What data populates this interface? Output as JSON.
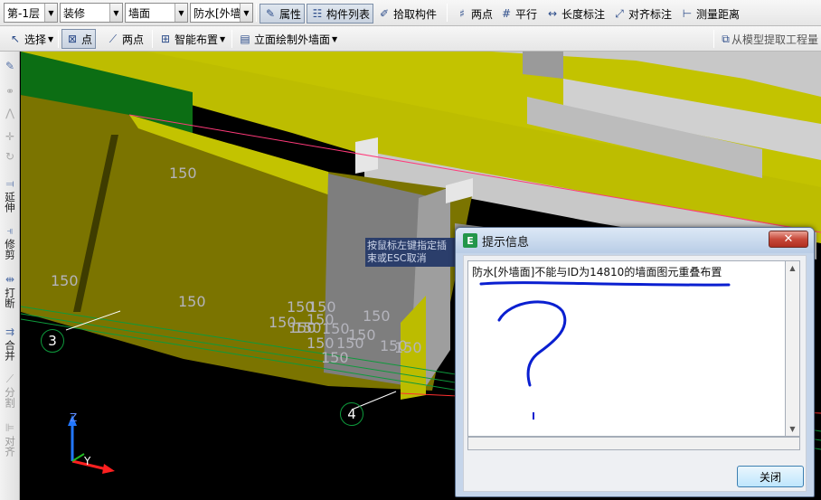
{
  "toolbar1": {
    "floor": "第-1层",
    "category": "装修",
    "element_type": "墙面",
    "element_name": "防水[外墙",
    "properties_label": "属性",
    "component_list_label": "构件列表",
    "pick_component_label": "拾取构件",
    "two_points_label": "两点",
    "parallel_label": "平行",
    "length_dim_label": "长度标注",
    "aligned_dim_label": "对齐标注",
    "measure_distance_label": "测量距离"
  },
  "toolbar2": {
    "select_label": "选择",
    "point_label": "点",
    "two_points_label": "两点",
    "smart_layout_label": "智能布置",
    "elevation_draw_label": "立面绘制外墙面",
    "extract_from_model_label": "从模型提取工程量"
  },
  "left_toolbar": {
    "extend": "延伸",
    "trim": "修剪",
    "break": "打断",
    "merge": "合并",
    "split": "分割",
    "align": "对齐"
  },
  "viewport": {
    "dimension_labels": [
      "150",
      "150",
      "150",
      "150",
      "150",
      "150",
      "150",
      "150",
      "150",
      "150",
      "150",
      "150",
      "150",
      "150",
      "150",
      "150",
      "150"
    ],
    "axis_labels": {
      "axis_3": "3",
      "axis_4": "4",
      "z": "Z",
      "y": "Y"
    },
    "tooltip_line1": "按鼠标左键指定插",
    "tooltip_line2": "束或ESC取消",
    "colors": {
      "wall_yellow": "#c4c400",
      "wall_olive": "#7b7400",
      "wall_grey": "#7e7e7e",
      "green": "#0c6e14",
      "background": "#000000"
    }
  },
  "dialog": {
    "title": "提示信息",
    "message": "防水[外墙面]不能与ID为14810的墙面图元重叠布置",
    "ok_label": "关闭",
    "close_glyph": "✕"
  }
}
